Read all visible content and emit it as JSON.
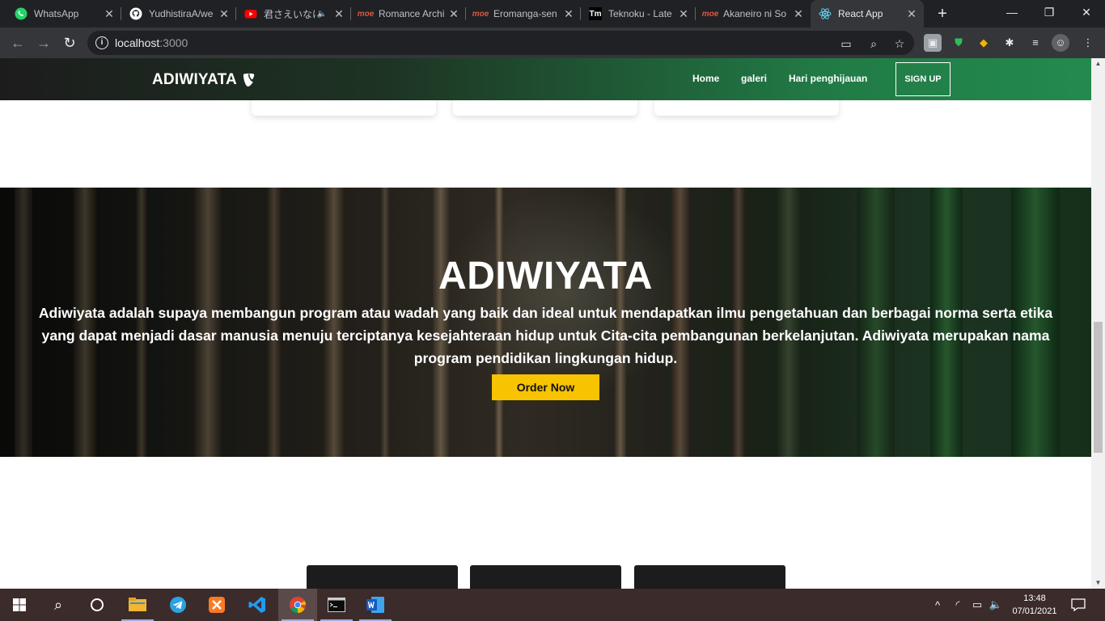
{
  "browser": {
    "tabs": [
      {
        "title": "WhatsApp",
        "icon": "whatsapp-icon"
      },
      {
        "title": "YudhistiraA/we",
        "icon": "github-icon"
      },
      {
        "title": "君さえいなけ",
        "icon": "youtube-icon"
      },
      {
        "title": "Romance Archi",
        "icon": "moe-icon"
      },
      {
        "title": "Eromanga-sen",
        "icon": "moe-icon"
      },
      {
        "title": "Teknoku - Late",
        "icon": "tm-icon"
      },
      {
        "title": "Akaneiro ni So",
        "icon": "moe-icon"
      },
      {
        "title": "React App",
        "icon": "react-icon"
      }
    ],
    "active_tab": "React App",
    "address": {
      "host": "localhost",
      "port": ":3000"
    },
    "tm_label": "Tm",
    "moe_label": "moe"
  },
  "site": {
    "brand": "ADIWIYATA",
    "menu": [
      "Home",
      "galeri",
      "Hari penghijauan"
    ],
    "signup": "SIGN UP"
  },
  "hero": {
    "title": "ADIWIYATA",
    "text": "Adiwiyata adalah supaya membangun program atau wadah yang baik dan ideal untuk mendapatkan ilmu pengetahuan dan berbagai norma serta etika yang dapat menjadi dasar manusia menuju terciptanya kesejahteraan hidup untuk Cita-cita pembangunan berkelanjutan. Adiwiyata merupakan nama program pendidikan lingkungan hidup.",
    "button": "Order Now"
  },
  "taskbar": {
    "time": "13:48",
    "date": "07/01/2021"
  },
  "colors": {
    "nav_start": "#1c1c1c",
    "nav_end": "#238a4e",
    "order_button": "#f8c301",
    "taskbar": "#3c2b2b"
  }
}
